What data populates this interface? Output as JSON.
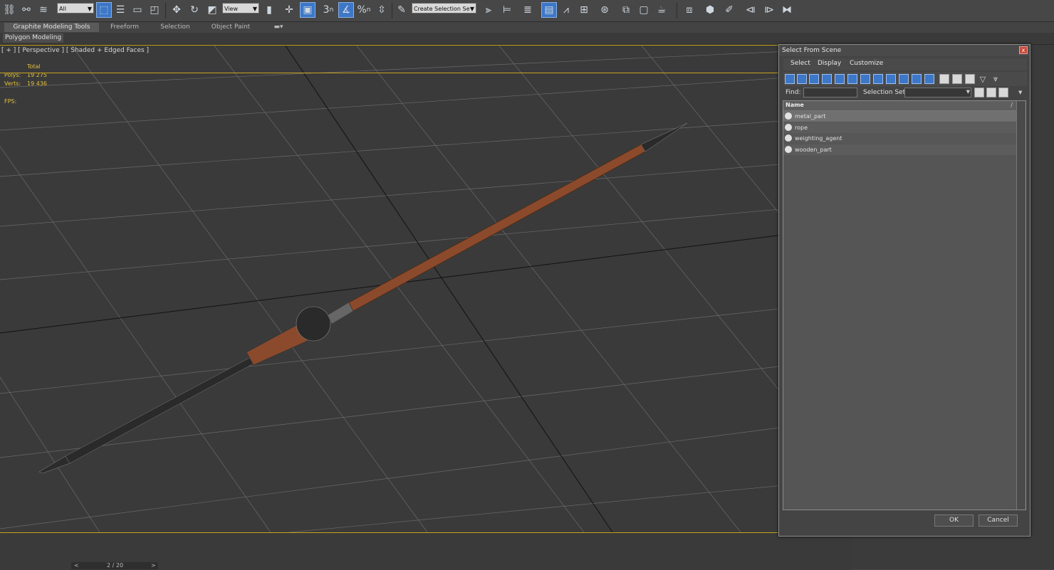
{
  "toolbar": {
    "filter_selected": "All",
    "refcoord_selected": "View",
    "selection_set_placeholder": "Create Selection Se",
    "snap_label": "3",
    "snap_sub": "n",
    "percent_label": "%",
    "percent_sub": "n"
  },
  "ribbon": {
    "tabs": [
      "Graphite Modeling Tools",
      "Freeform",
      "Selection",
      "Object Paint"
    ]
  },
  "subbar": {
    "label": "Polygon Modeling"
  },
  "viewport": {
    "label": "[ + ] [ Perspective ] [ Shaded + Edged Faces ]",
    "stats_header": "Total",
    "polys_label": "Polys:",
    "polys_value": "19 275",
    "verts_label": "Verts:",
    "verts_value": "19 436",
    "fps_label": "FPS:"
  },
  "timeline": {
    "frame": "2 / 20",
    "prev": "<",
    "next": ">"
  },
  "dialog": {
    "title": "Select From Scene",
    "menu": [
      "Select",
      "Display",
      "Customize"
    ],
    "find_label": "Find:",
    "selection_set_label": "Selection Set:",
    "column_name": "Name",
    "sort_glyph": "/",
    "items": [
      {
        "name": "metal_part",
        "selected": true
      },
      {
        "name": "rope",
        "selected": false
      },
      {
        "name": "weighting_agent",
        "selected": false
      },
      {
        "name": "wooden_part",
        "selected": false
      }
    ],
    "ok_label": "OK",
    "cancel_label": "Cancel",
    "close_glyph": "x"
  },
  "colors": {
    "accent": "#3d77c7",
    "viewport_border": "#c7a21c",
    "stats_text": "#e4c03a",
    "shaft_wood": "#8b4a2b"
  }
}
